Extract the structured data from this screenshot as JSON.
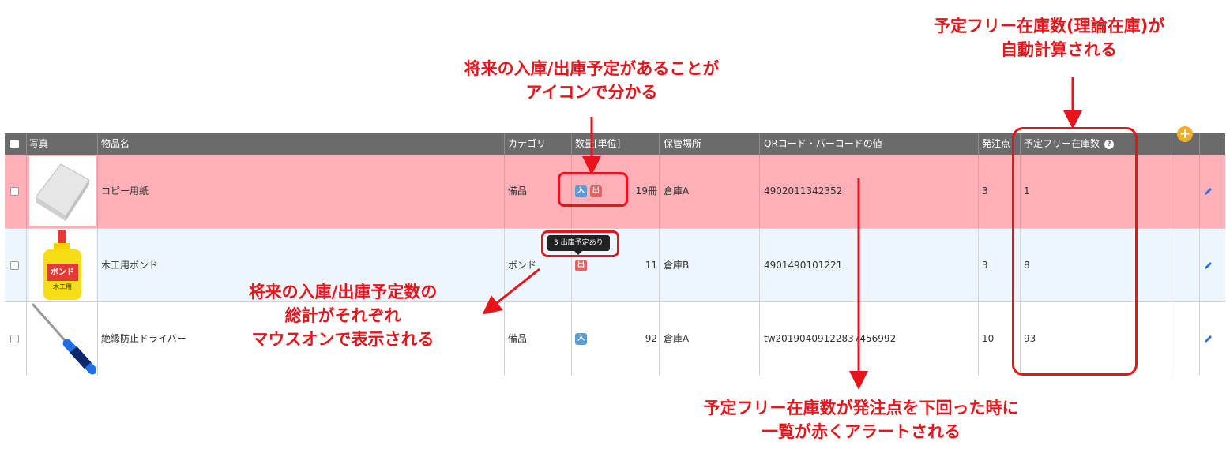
{
  "annotations": {
    "top_right": [
      "予定フリー在庫数(理論在庫)が",
      "自動計算される"
    ],
    "top_middle": [
      "将来の入庫/出庫予定があることが",
      "アイコンで分かる"
    ],
    "mid_left": [
      "将来の入庫/出庫予定数の",
      "総計がそれぞれ",
      "マウスオンで表示される"
    ],
    "bottom": [
      "予定フリー在庫数が発注点を下回った時に",
      "一覧が赤くアラートされる"
    ]
  },
  "table": {
    "headers": {
      "photo": "写真",
      "name": "物品名",
      "category": "カテゴリ",
      "quantity": "数量[単位]",
      "location": "保管場所",
      "code": "QRコード・バーコードの値",
      "reorder": "発注点",
      "free_stock": "予定フリー在庫数"
    },
    "rows": [
      {
        "image": "copy-paper-image",
        "name": "コピー用紙",
        "category": "備品",
        "quantity": "19冊",
        "location": "倉庫A",
        "code": "4902011342352",
        "reorder": "3",
        "free_stock": "1",
        "icons": [
          "入",
          "出"
        ],
        "alert": true
      },
      {
        "image": "bond-bottle-image",
        "name": "木工用ボンド",
        "category": "ボンド",
        "quantity": "11",
        "location": "倉庫B",
        "code": "4901490101221",
        "reorder": "3",
        "free_stock": "8",
        "icons": [
          "出"
        ],
        "alert": false
      },
      {
        "image": "screwdriver-image",
        "name": "絶縁防止ドライバー",
        "category": "備品",
        "quantity": "92",
        "location": "倉庫A",
        "code": "tw20190409122837456992",
        "reorder": "10",
        "free_stock": "93",
        "icons": [
          "入"
        ],
        "alert": false
      }
    ],
    "tooltip": "3 出庫予定あり",
    "image_label_bond": "ボンド",
    "image_label_bond_sub": "木工用"
  },
  "colors": {
    "alert_row": "#fdb0b7",
    "selected_row": "#edf5fd",
    "annotation": "#e8141b"
  }
}
